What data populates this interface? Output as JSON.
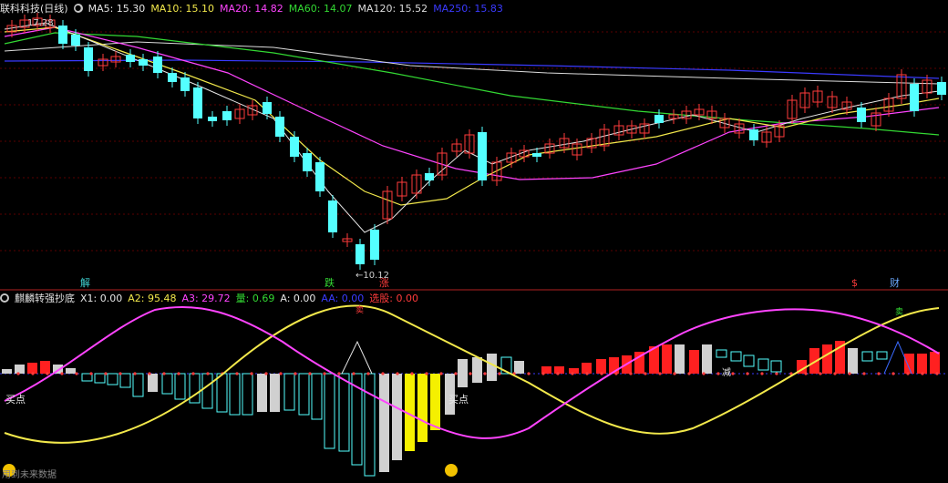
{
  "main": {
    "title": "联科科技(日线)",
    "ma": [
      {
        "label": "MA5: 15.30",
        "color": "#e6e6e6"
      },
      {
        "label": "MA10: 15.10",
        "color": "#f2e84b"
      },
      {
        "label": "MA20: 14.82",
        "color": "#ff44ff"
      },
      {
        "label": "MA60: 14.07",
        "color": "#33d933"
      },
      {
        "label": "MA120: 15.52",
        "color": "#dcdcdc"
      },
      {
        "label": "MA250: 15.83",
        "color": "#3a3aff"
      }
    ],
    "high_label": "17.28",
    "low_label": "←10.12",
    "markers": [
      {
        "text": "解",
        "color": "#3fd3d3"
      },
      {
        "text": "跌",
        "color": "#33d933"
      },
      {
        "text": "涨",
        "color": "#ff3b3b"
      },
      {
        "text": "$",
        "color": "#ff3b3b"
      },
      {
        "text": "财",
        "color": "#6aa8ff"
      }
    ]
  },
  "indicator": {
    "title": "麒麟转强抄底",
    "items": [
      {
        "label": "X1: 0.00",
        "color": "#e6e6e6"
      },
      {
        "label": "A2: 95.48",
        "color": "#f2e84b"
      },
      {
        "label": "A3: 29.72",
        "color": "#ff44ff"
      },
      {
        "label": "量: 0.69",
        "color": "#33d933"
      },
      {
        "label": "A: 0.00",
        "color": "#e6e6e6"
      },
      {
        "label": "AA: 0.00",
        "color": "#3a3aff"
      },
      {
        "label": "选股: 0.00",
        "color": "#ff3b3b"
      }
    ],
    "buy_label": "买点",
    "sell_label": "卖",
    "reduce_label": "减",
    "footer": "用到未来数据"
  },
  "colors": {
    "up": "#ff3b3b",
    "down": "#54ffff",
    "grid": "#8b0000",
    "divider": "#b22222"
  }
}
